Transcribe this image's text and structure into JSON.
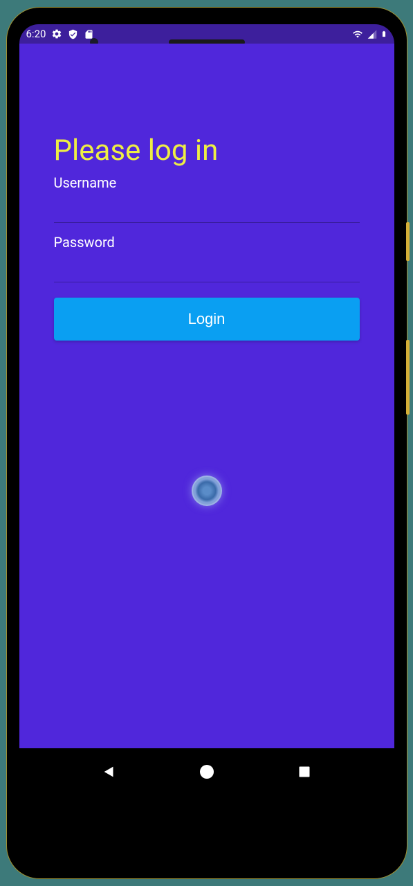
{
  "status": {
    "time": "6:20"
  },
  "login": {
    "title": "Please log in",
    "username_label": "Username",
    "password_label": "Password",
    "button_label": "Login"
  }
}
